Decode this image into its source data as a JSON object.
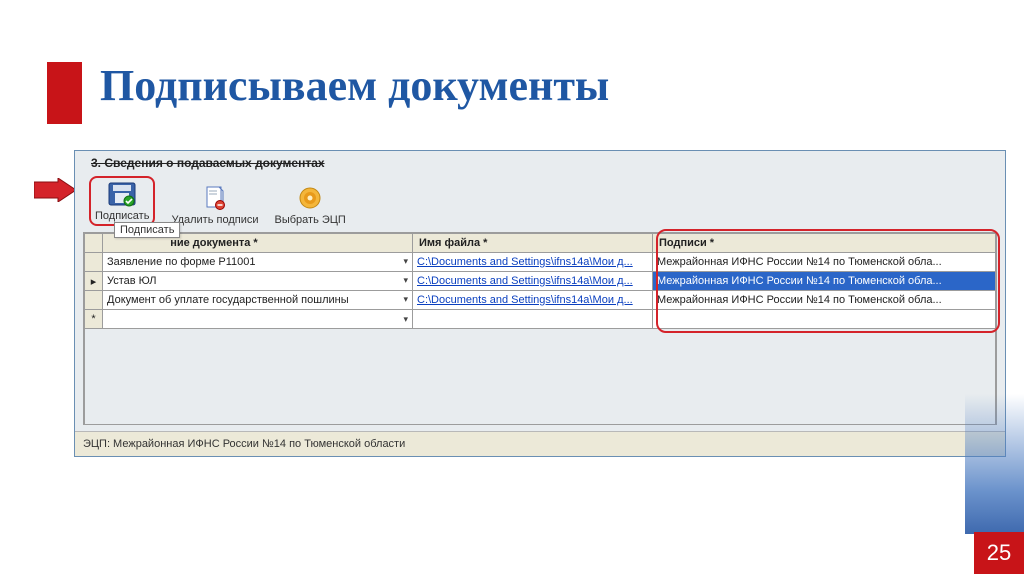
{
  "slide": {
    "title": "Подписываем документы",
    "page_number": "25"
  },
  "panel": {
    "section_title": "3. Сведения о подаваемых документах",
    "toolbar": {
      "sign": "Подписать",
      "delete_sig": "Удалить подписи",
      "choose_ecp": "Выбрать ЭЦП"
    },
    "tooltip": "Подписать",
    "columns": {
      "doc_name": "Наименование документа *",
      "doc_name_visible_fragment": "ние документа *",
      "file": "Имя файла *",
      "sig": "Подписи *"
    },
    "rows": [
      {
        "marker": "",
        "doc": "Заявление по форме Р11001",
        "file": "C:\\Documents and Settings\\ifns14a\\Мои д...",
        "sig": "Межрайонная ИФНС России №14 по Тюменской обла...",
        "selected": false
      },
      {
        "marker": "▸",
        "doc": "Устав ЮЛ",
        "file": "C:\\Documents and Settings\\ifns14a\\Мои д...",
        "sig": "Межрайонная ИФНС России №14 по Тюменской обла...",
        "selected": true
      },
      {
        "marker": "",
        "doc": "Документ об уплате государственной пошлины",
        "file": "C:\\Documents and Settings\\ifns14a\\Мои д...",
        "sig": "Межрайонная ИФНС России №14 по Тюменской обла...",
        "selected": false
      },
      {
        "marker": "*",
        "doc": "",
        "file": "",
        "sig": "",
        "selected": false
      }
    ],
    "status": "ЭЦП: Межрайонная ИФНС России №14 по Тюменской области"
  }
}
